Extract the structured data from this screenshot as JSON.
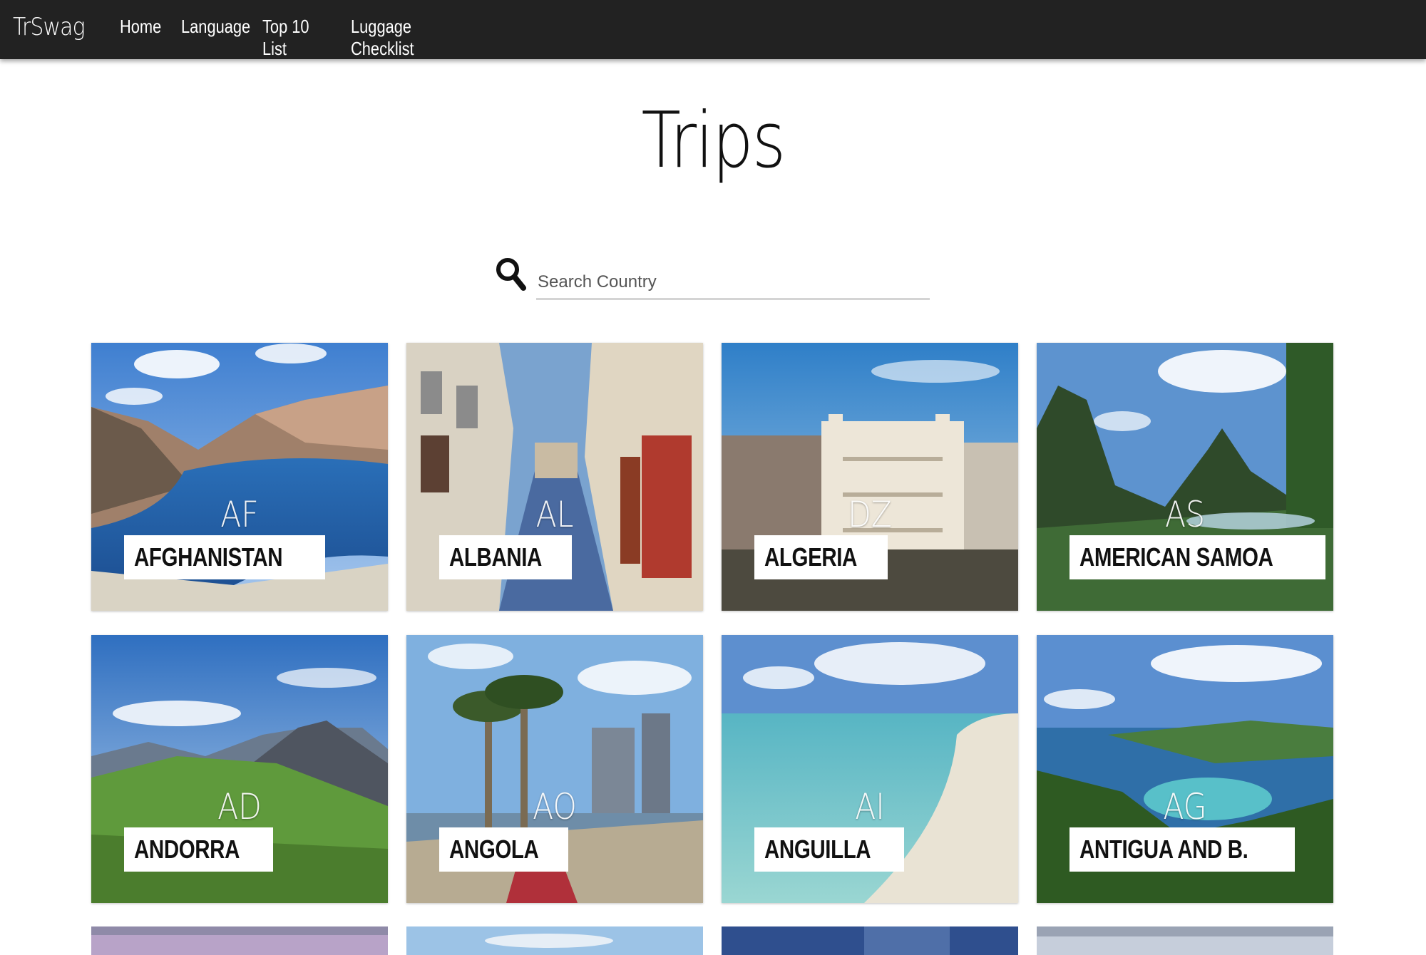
{
  "navbar": {
    "brand": "TrSwag",
    "links": [
      "Home",
      "Language",
      "Top 10 List",
      "Luggage Checklist"
    ]
  },
  "page": {
    "title": "Trips"
  },
  "search": {
    "placeholder": "Search Country"
  },
  "countries": [
    {
      "code": "AF",
      "name": "AFGHANISTAN"
    },
    {
      "code": "AL",
      "name": "ALBANIA"
    },
    {
      "code": "DZ",
      "name": "ALGERIA"
    },
    {
      "code": "AS",
      "name": "AMERICAN SAMOA"
    },
    {
      "code": "AD",
      "name": "ANDORRA"
    },
    {
      "code": "AO",
      "name": "ANGOLA"
    },
    {
      "code": "AI",
      "name": "ANGUILLA"
    },
    {
      "code": "AG",
      "name": "ANTIGUA AND B."
    }
  ],
  "colors": {
    "navbar_bg": "#222222",
    "search_underline": "#d4d4d4",
    "label_bg": "#ffffff"
  }
}
